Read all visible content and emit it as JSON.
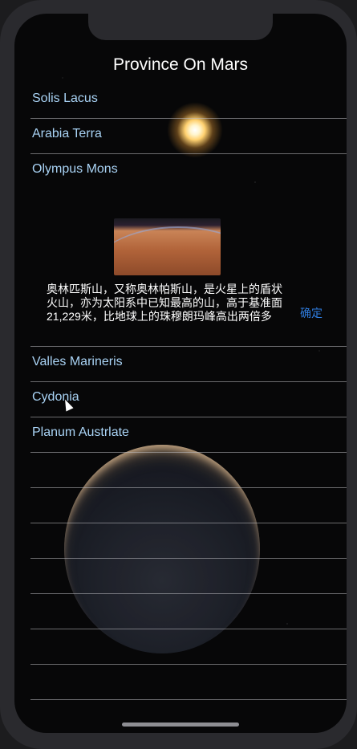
{
  "title": "Province On Mars",
  "rows_top": [
    "Solis Lacus",
    "Arabia Terra",
    "Olympus Mons"
  ],
  "popup": {
    "description": "奥林匹斯山，又称奥林帕斯山，是火星上的盾状火山，亦为太阳系中已知最高的山，高于基准面21,229米，比地球上的珠穆朗玛峰高出两倍多",
    "confirm_label": "确定"
  },
  "rows_bottom": [
    "Valles Marineris",
    "Cydonia",
    "Planum Austrlate",
    "",
    "",
    "",
    "",
    "",
    "",
    "",
    ""
  ]
}
